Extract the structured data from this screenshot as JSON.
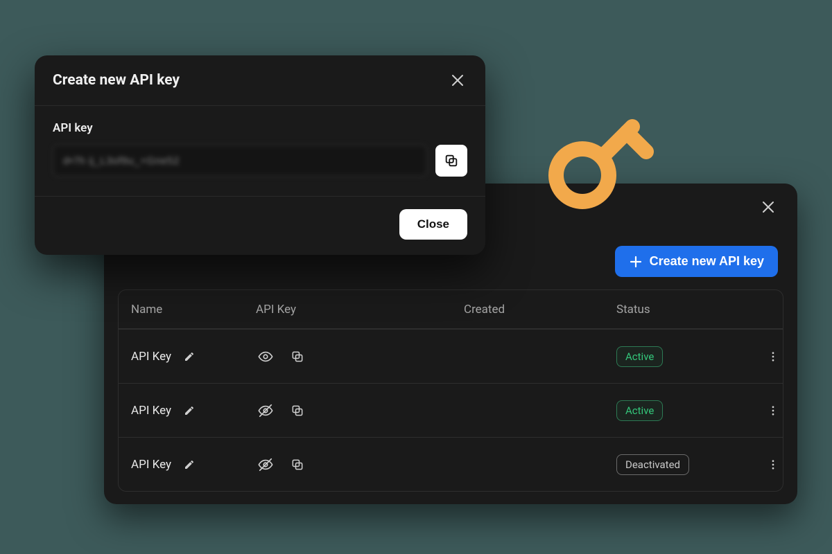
{
  "dialog": {
    "title": "Create new API key",
    "field_label": "API key",
    "key_value": "d•7h ij_L3of9u_+Gne52",
    "close_label": "Close"
  },
  "list_panel": {
    "create_button_label": "Create new API key",
    "columns": {
      "name": "Name",
      "api_key": "API Key",
      "created": "Created",
      "status": "Status"
    },
    "rows": [
      {
        "name": "API Key",
        "visibility": "visible",
        "created": "",
        "status": "Active",
        "status_kind": "active"
      },
      {
        "name": "API Key",
        "visibility": "hidden",
        "created": "",
        "status": "Active",
        "status_kind": "active"
      },
      {
        "name": "API Key",
        "visibility": "hidden",
        "created": "",
        "status": "Deactivated",
        "status_kind": "deactivated"
      }
    ]
  },
  "icons": {
    "close": "close-icon",
    "copy": "copy-icon",
    "plus": "plus-icon",
    "pencil": "pencil-icon",
    "eye": "eye-icon",
    "eye_off": "eye-off-icon",
    "kebab": "kebab-icon",
    "key_illustration": "key-icon"
  },
  "colors": {
    "accent_primary": "#1f6feb",
    "status_active": "#34c77b",
    "key_illustration": "#f2a94b"
  }
}
